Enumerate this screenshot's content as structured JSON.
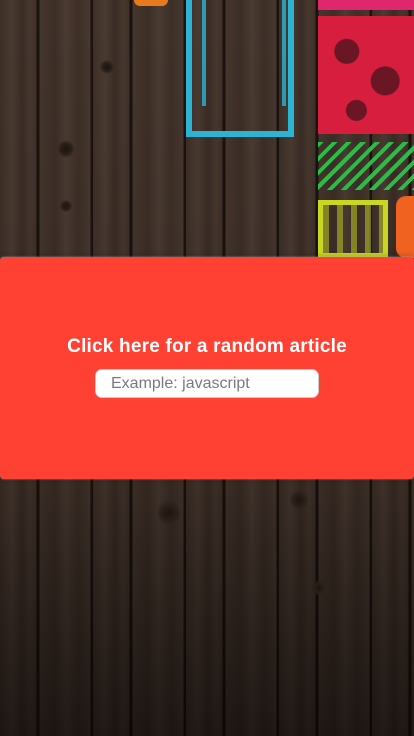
{
  "panel": {
    "random_link_label": "Click here for a random article",
    "search_placeholder": "Example: javascript",
    "search_value": ""
  },
  "colors": {
    "panel_bg": "#ff4134",
    "text": "#ffffff"
  }
}
